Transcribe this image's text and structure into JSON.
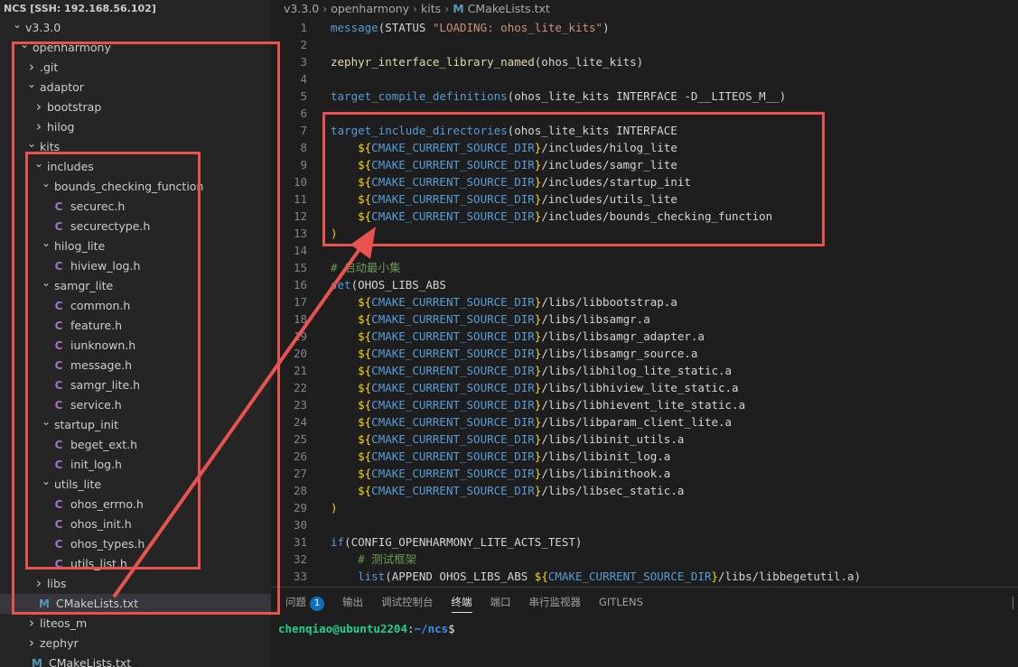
{
  "window": {
    "title": "NCS [SSH: 192.168.56.102]"
  },
  "explorer": {
    "items": [
      {
        "label": "v3.3.0",
        "depth": 0,
        "kind": "folder",
        "open": true
      },
      {
        "label": "openharmony",
        "depth": 1,
        "kind": "folder",
        "open": true
      },
      {
        "label": ".git",
        "depth": 2,
        "kind": "folder",
        "open": false
      },
      {
        "label": "adaptor",
        "depth": 2,
        "kind": "folder",
        "open": true
      },
      {
        "label": "bootstrap",
        "depth": 3,
        "kind": "folder",
        "open": false
      },
      {
        "label": "hilog",
        "depth": 3,
        "kind": "folder",
        "open": false
      },
      {
        "label": "kits",
        "depth": 2,
        "kind": "folder",
        "open": true
      },
      {
        "label": "includes",
        "depth": 3,
        "kind": "folder",
        "open": true
      },
      {
        "label": "bounds_checking_function",
        "depth": 4,
        "kind": "folder",
        "open": true
      },
      {
        "label": "securec.h",
        "depth": 5,
        "kind": "c"
      },
      {
        "label": "securectype.h",
        "depth": 5,
        "kind": "c"
      },
      {
        "label": "hilog_lite",
        "depth": 4,
        "kind": "folder",
        "open": true
      },
      {
        "label": "hiview_log.h",
        "depth": 5,
        "kind": "c"
      },
      {
        "label": "samgr_lite",
        "depth": 4,
        "kind": "folder",
        "open": true
      },
      {
        "label": "common.h",
        "depth": 5,
        "kind": "c"
      },
      {
        "label": "feature.h",
        "depth": 5,
        "kind": "c"
      },
      {
        "label": "iunknown.h",
        "depth": 5,
        "kind": "c"
      },
      {
        "label": "message.h",
        "depth": 5,
        "kind": "c"
      },
      {
        "label": "samgr_lite.h",
        "depth": 5,
        "kind": "c"
      },
      {
        "label": "service.h",
        "depth": 5,
        "kind": "c"
      },
      {
        "label": "startup_init",
        "depth": 4,
        "kind": "folder",
        "open": true
      },
      {
        "label": "beget_ext.h",
        "depth": 5,
        "kind": "c"
      },
      {
        "label": "init_log.h",
        "depth": 5,
        "kind": "c"
      },
      {
        "label": "utils_lite",
        "depth": 4,
        "kind": "folder",
        "open": true
      },
      {
        "label": "ohos_errno.h",
        "depth": 5,
        "kind": "c"
      },
      {
        "label": "ohos_init.h",
        "depth": 5,
        "kind": "c"
      },
      {
        "label": "ohos_types.h",
        "depth": 5,
        "kind": "c"
      },
      {
        "label": "utils_list.h",
        "depth": 5,
        "kind": "c"
      },
      {
        "label": "libs",
        "depth": 3,
        "kind": "folder",
        "open": false
      },
      {
        "label": "CMakeLists.txt",
        "depth": 3,
        "kind": "m",
        "selected": true
      },
      {
        "label": "liteos_m",
        "depth": 2,
        "kind": "folder",
        "open": false
      },
      {
        "label": "zephyr",
        "depth": 2,
        "kind": "folder",
        "open": false
      },
      {
        "label": "CMakeLists.txt",
        "depth": 2,
        "kind": "m"
      }
    ]
  },
  "breadcrumb": [
    "v3.3.0",
    "openharmony",
    "kits",
    "CMakeLists.txt"
  ],
  "editor": {
    "lines": [
      {
        "n": "1",
        "tokens": [
          [
            "fn",
            "message"
          ],
          [
            "txt",
            "(STATUS "
          ],
          [
            "str",
            "\"LOADING: ohos_lite_kits\""
          ],
          [
            "txt",
            ")"
          ]
        ]
      },
      {
        "n": "2",
        "tokens": []
      },
      {
        "n": "3",
        "tokens": [
          [
            "fy",
            "zephyr_interface_library_named"
          ],
          [
            "txt",
            "(ohos_lite_kits)"
          ]
        ]
      },
      {
        "n": "4",
        "tokens": []
      },
      {
        "n": "5",
        "tokens": [
          [
            "fn",
            "target_compile_definitions"
          ],
          [
            "txt",
            "(ohos_lite_kits INTERFACE -D__LITEOS_M__)"
          ]
        ]
      },
      {
        "n": "6",
        "tokens": []
      },
      {
        "n": "7",
        "tokens": [
          [
            "fn",
            "target_include_directories"
          ],
          [
            "txt",
            "(ohos_lite_kits INTERFACE"
          ]
        ]
      },
      {
        "n": "8",
        "tokens": [
          [
            "txt",
            "    "
          ],
          [
            "br",
            "${"
          ],
          [
            "var",
            "CMAKE_CURRENT_SOURCE_DIR"
          ],
          [
            "br",
            "}"
          ],
          [
            "txt",
            "/includes/hilog_lite"
          ]
        ]
      },
      {
        "n": "9",
        "tokens": [
          [
            "txt",
            "    "
          ],
          [
            "br",
            "${"
          ],
          [
            "var",
            "CMAKE_CURRENT_SOURCE_DIR"
          ],
          [
            "br",
            "}"
          ],
          [
            "txt",
            "/includes/samgr_lite"
          ]
        ]
      },
      {
        "n": "10",
        "tokens": [
          [
            "txt",
            "    "
          ],
          [
            "br",
            "${"
          ],
          [
            "var",
            "CMAKE_CURRENT_SOURCE_DIR"
          ],
          [
            "br",
            "}"
          ],
          [
            "txt",
            "/includes/startup_init"
          ]
        ]
      },
      {
        "n": "11",
        "tokens": [
          [
            "txt",
            "    "
          ],
          [
            "br",
            "${"
          ],
          [
            "var",
            "CMAKE_CURRENT_SOURCE_DIR"
          ],
          [
            "br",
            "}"
          ],
          [
            "txt",
            "/includes/utils_lite"
          ]
        ]
      },
      {
        "n": "12",
        "tokens": [
          [
            "txt",
            "    "
          ],
          [
            "br",
            "${"
          ],
          [
            "var",
            "CMAKE_CURRENT_SOURCE_DIR"
          ],
          [
            "br",
            "}"
          ],
          [
            "txt",
            "/includes/bounds_checking_function"
          ]
        ]
      },
      {
        "n": "13",
        "tokens": [
          [
            "br",
            ")"
          ]
        ]
      },
      {
        "n": "14",
        "tokens": []
      },
      {
        "n": "15",
        "tokens": [
          [
            "cm",
            "# 启动最小集"
          ]
        ]
      },
      {
        "n": "16",
        "tokens": [
          [
            "kw",
            "set"
          ],
          [
            "txt",
            "(OHOS_LIBS_ABS"
          ]
        ]
      },
      {
        "n": "17",
        "tokens": [
          [
            "txt",
            "    "
          ],
          [
            "br",
            "${"
          ],
          [
            "var",
            "CMAKE_CURRENT_SOURCE_DIR"
          ],
          [
            "br",
            "}"
          ],
          [
            "txt",
            "/libs/libbootstrap.a"
          ]
        ]
      },
      {
        "n": "18",
        "tokens": [
          [
            "txt",
            "    "
          ],
          [
            "br",
            "${"
          ],
          [
            "var",
            "CMAKE_CURRENT_SOURCE_DIR"
          ],
          [
            "br",
            "}"
          ],
          [
            "txt",
            "/libs/libsamgr.a"
          ]
        ]
      },
      {
        "n": "19",
        "tokens": [
          [
            "txt",
            "    "
          ],
          [
            "br",
            "${"
          ],
          [
            "var",
            "CMAKE_CURRENT_SOURCE_DIR"
          ],
          [
            "br",
            "}"
          ],
          [
            "txt",
            "/libs/libsamgr_adapter.a"
          ]
        ]
      },
      {
        "n": "20",
        "tokens": [
          [
            "txt",
            "    "
          ],
          [
            "br",
            "${"
          ],
          [
            "var",
            "CMAKE_CURRENT_SOURCE_DIR"
          ],
          [
            "br",
            "}"
          ],
          [
            "txt",
            "/libs/libsamgr_source.a"
          ]
        ]
      },
      {
        "n": "21",
        "tokens": [
          [
            "txt",
            "    "
          ],
          [
            "br",
            "${"
          ],
          [
            "var",
            "CMAKE_CURRENT_SOURCE_DIR"
          ],
          [
            "br",
            "}"
          ],
          [
            "txt",
            "/libs/libhilog_lite_static.a"
          ]
        ]
      },
      {
        "n": "22",
        "tokens": [
          [
            "txt",
            "    "
          ],
          [
            "br",
            "${"
          ],
          [
            "var",
            "CMAKE_CURRENT_SOURCE_DIR"
          ],
          [
            "br",
            "}"
          ],
          [
            "txt",
            "/libs/libhiview_lite_static.a"
          ]
        ]
      },
      {
        "n": "23",
        "tokens": [
          [
            "txt",
            "    "
          ],
          [
            "br",
            "${"
          ],
          [
            "var",
            "CMAKE_CURRENT_SOURCE_DIR"
          ],
          [
            "br",
            "}"
          ],
          [
            "txt",
            "/libs/libhievent_lite_static.a"
          ]
        ]
      },
      {
        "n": "24",
        "tokens": [
          [
            "txt",
            "    "
          ],
          [
            "br",
            "${"
          ],
          [
            "var",
            "CMAKE_CURRENT_SOURCE_DIR"
          ],
          [
            "br",
            "}"
          ],
          [
            "txt",
            "/libs/libparam_client_lite.a"
          ]
        ]
      },
      {
        "n": "25",
        "tokens": [
          [
            "txt",
            "    "
          ],
          [
            "br",
            "${"
          ],
          [
            "var",
            "CMAKE_CURRENT_SOURCE_DIR"
          ],
          [
            "br",
            "}"
          ],
          [
            "txt",
            "/libs/libinit_utils.a"
          ]
        ]
      },
      {
        "n": "26",
        "tokens": [
          [
            "txt",
            "    "
          ],
          [
            "br",
            "${"
          ],
          [
            "var",
            "CMAKE_CURRENT_SOURCE_DIR"
          ],
          [
            "br",
            "}"
          ],
          [
            "txt",
            "/libs/libinit_log.a"
          ]
        ]
      },
      {
        "n": "27",
        "tokens": [
          [
            "txt",
            "    "
          ],
          [
            "br",
            "${"
          ],
          [
            "var",
            "CMAKE_CURRENT_SOURCE_DIR"
          ],
          [
            "br",
            "}"
          ],
          [
            "txt",
            "/libs/libinithook.a"
          ]
        ]
      },
      {
        "n": "28",
        "tokens": [
          [
            "txt",
            "    "
          ],
          [
            "br",
            "${"
          ],
          [
            "var",
            "CMAKE_CURRENT_SOURCE_DIR"
          ],
          [
            "br",
            "}"
          ],
          [
            "txt",
            "/libs/libsec_static.a"
          ]
        ]
      },
      {
        "n": "29",
        "tokens": [
          [
            "br",
            ")"
          ]
        ]
      },
      {
        "n": "30",
        "tokens": []
      },
      {
        "n": "31",
        "tokens": [
          [
            "kw",
            "if"
          ],
          [
            "txt",
            "(CONFIG_OPENHARMONY_LITE_ACTS_TEST)"
          ]
        ]
      },
      {
        "n": "32",
        "tokens": [
          [
            "txt",
            "    "
          ],
          [
            "cm",
            "# 测试框架"
          ]
        ]
      },
      {
        "n": "33",
        "tokens": [
          [
            "txt",
            "    "
          ],
          [
            "kw",
            "list"
          ],
          [
            "txt",
            "(APPEND OHOS_LIBS_ABS "
          ],
          [
            "br",
            "${"
          ],
          [
            "var",
            "CMAKE_CURRENT_SOURCE_DIR"
          ],
          [
            "br",
            "}"
          ],
          [
            "txt",
            "/libs/libbegetutil.a)"
          ]
        ]
      }
    ]
  },
  "panel": {
    "tabs": [
      {
        "label": "问题",
        "badge": "1"
      },
      {
        "label": "输出"
      },
      {
        "label": "调试控制台"
      },
      {
        "label": "终端",
        "active": true
      },
      {
        "label": "端口"
      },
      {
        "label": "串行监视器"
      },
      {
        "label": "GITLENS"
      }
    ],
    "terminal": {
      "user": "chenqiao@ubuntu2204",
      "sep": ":",
      "path": "~/ncs",
      "prompt": "$"
    }
  },
  "colors": {
    "annotation": "#e8534f",
    "accent": "#0e70c0"
  }
}
